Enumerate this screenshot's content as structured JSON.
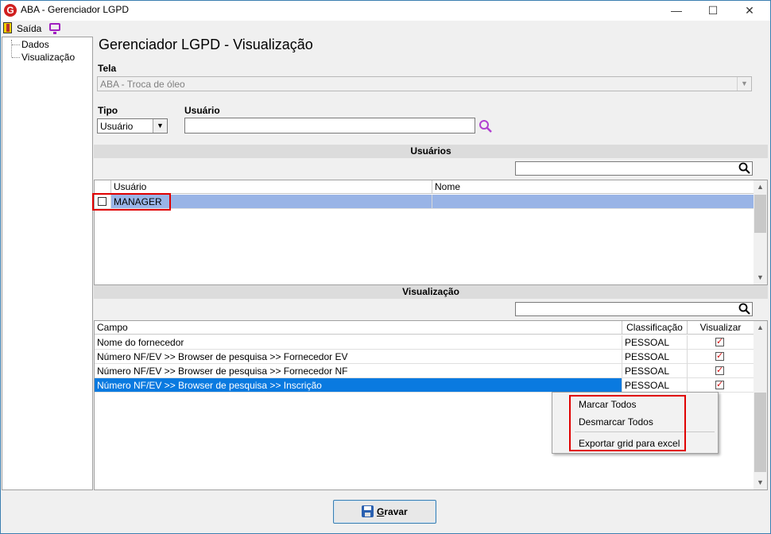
{
  "window": {
    "title": "ABA - Gerenciador LGPD",
    "app_icon_letter": "G",
    "minimize_glyph": "—",
    "maximize_glyph": "☐",
    "close_glyph": "✕",
    "accent_color": "#3c7fb1"
  },
  "toolbar": {
    "exit_label": "Saída",
    "exit_icon": "exit-door-icon",
    "screen_icon": "monitor-icon"
  },
  "tree": {
    "items": [
      {
        "label": "Dados"
      },
      {
        "label": "Visualização"
      }
    ]
  },
  "main": {
    "title": "Gerenciador LGPD - Visualização",
    "tela": {
      "label": "Tela",
      "value": "ABA - Troca de óleo"
    },
    "tipo": {
      "label": "Tipo",
      "value": "Usuário"
    },
    "usuario": {
      "label": "Usuário",
      "value": "",
      "search_icon": "search-icon"
    }
  },
  "usuarios_section": {
    "title": "Usuários",
    "filter_value": "",
    "columns": [
      "Usuário",
      "Nome"
    ],
    "rows": [
      {
        "usuario": "MANAGER",
        "nome": "",
        "checked": false,
        "selected": true
      }
    ]
  },
  "visualizacao_section": {
    "title": "Visualização",
    "filter_value": "",
    "columns": [
      "Campo",
      "Classificação",
      "Visualizar"
    ],
    "rows": [
      {
        "campo": "Nome do fornecedor",
        "classificacao": "PESSOAL",
        "visualizar": true
      },
      {
        "campo": "Número NF/EV >> Browser de pesquisa >> Fornecedor EV",
        "classificacao": "PESSOAL",
        "visualizar": true
      },
      {
        "campo": "Número NF/EV >> Browser de pesquisa >> Fornecedor NF",
        "classificacao": "PESSOAL",
        "visualizar": true
      },
      {
        "campo": "Número NF/EV >> Browser de pesquisa >> Inscrição",
        "classificacao": "PESSOAL",
        "visualizar": true,
        "selected": true
      }
    ]
  },
  "context_menu": {
    "items": [
      "Marcar Todos",
      "Desmarcar Todos",
      "Exportar grid para excel"
    ]
  },
  "save_button": {
    "label": "Gravar",
    "icon": "floppy-disk-icon"
  },
  "colors": {
    "highlight_red": "#e00000",
    "row_selected_light": "#99b4e6",
    "row_selected_dark": "#0a7ae0",
    "check_red": "#d01010"
  }
}
